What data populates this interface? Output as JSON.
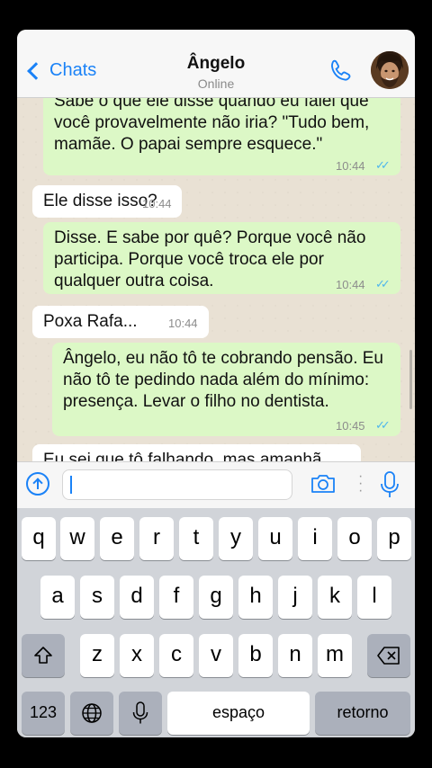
{
  "header": {
    "back_label": "Chats",
    "contact_name": "Ângelo",
    "status": "Online"
  },
  "messages": [
    {
      "dir": "out",
      "text": "Sabe o que ele disse quando eu falei que você provavelmente não iria? \"Tudo bem, mamãe. O papai sempre esquece.\"",
      "time": "10:44",
      "ticks": "✓✓"
    },
    {
      "dir": "in",
      "text": "Ele disse isso?",
      "time": "10:44"
    },
    {
      "dir": "out",
      "text": "Disse. E sabe por quê? Porque você não participa. Porque você troca ele por qualquer outra coisa.",
      "time": "10:44",
      "ticks": "✓✓"
    },
    {
      "dir": "in",
      "text": "Poxa Rafa...",
      "time": "10:44"
    },
    {
      "dir": "out",
      "text": "Ângelo, eu não tô te cobrando pensão. Eu não tô te pedindo nada além do mínimo: presença. Levar o filho no dentista.",
      "time": "10:45",
      "ticks": "✓✓"
    },
    {
      "dir": "in",
      "text": "Eu sei que tô falhando, mas amanhã...",
      "time": ""
    }
  ],
  "input": {
    "value": ""
  },
  "keyboard": {
    "row1": [
      "q",
      "w",
      "e",
      "r",
      "t",
      "y",
      "u",
      "i",
      "o",
      "p"
    ],
    "row2": [
      "a",
      "s",
      "d",
      "f",
      "g",
      "h",
      "j",
      "k",
      "l"
    ],
    "row3": [
      "z",
      "x",
      "c",
      "v",
      "b",
      "n",
      "m"
    ],
    "numbers_label": "123",
    "space_label": "espaço",
    "return_label": "retorno"
  },
  "colors": {
    "accent": "#1a82f7",
    "outgoing_bubble": "#dcf8c6",
    "incoming_bubble": "#ffffff",
    "read_ticks": "#4fb6ec",
    "chat_background": "#e9e1d4"
  },
  "icons": [
    "back-chevron-icon",
    "phone-icon",
    "avatar",
    "upload-icon",
    "camera-icon",
    "more-icon",
    "microphone-icon",
    "shift-icon",
    "backspace-icon",
    "globe-icon",
    "keyboard-mic-icon"
  ]
}
